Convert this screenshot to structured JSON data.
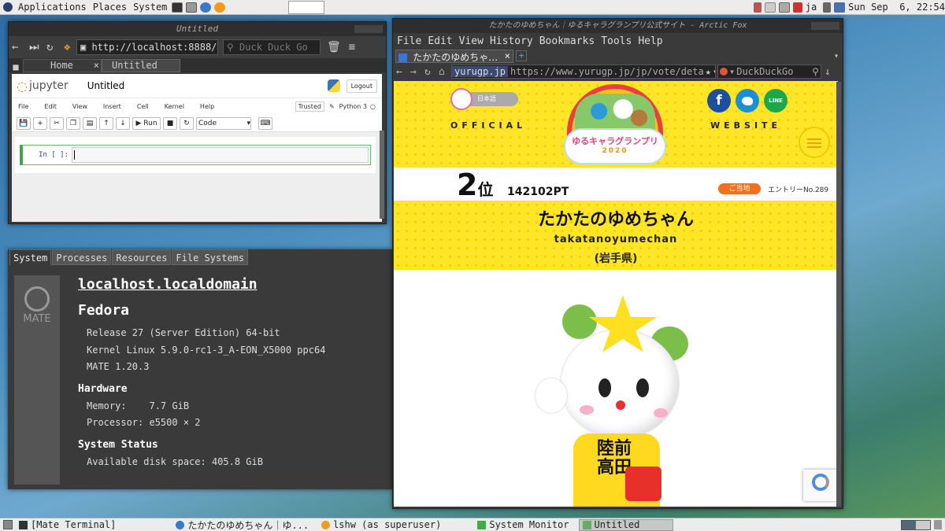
{
  "top_panel": {
    "menus": [
      "Applications",
      "Places",
      "System"
    ],
    "lang": "ja",
    "clock": "Sun Sep  6, 22:54"
  },
  "jupyter_window": {
    "title": "Untitled",
    "url": "http://localhost:8888/n",
    "search_placeholder": "Duck Duck Go",
    "tabs": [
      {
        "label": "Home"
      },
      {
        "label": "Untitled"
      }
    ],
    "app_name": "jupyter",
    "notebook_title": "Untitled",
    "logout": "Logout",
    "menu": [
      "File",
      "Edit",
      "View",
      "Insert",
      "Cell",
      "Kernel",
      "Help"
    ],
    "trusted": "Trusted",
    "kernel": "Python 3",
    "run": "Run",
    "cell_type": "Code",
    "prompt": "In [ ]:"
  },
  "sysmon": {
    "tabs": [
      "System",
      "Processes",
      "Resources",
      "File Systems"
    ],
    "logo_text": "MATE",
    "hostname": "localhost.localdomain",
    "os": "Fedora",
    "release": "Release 27 (Server Edition) 64-bit",
    "kernel": "Kernel Linux 5.9.0-rc1-3_A-EON_X5000 ppc64",
    "mate": "MATE 1.20.3",
    "hardware_heading": "Hardware",
    "memory_label": "Memory:",
    "memory_value": "7.7 GiB",
    "processor_label": "Processor:",
    "processor_value": "e5500 × 2",
    "status_heading": "System Status",
    "disk": "Available disk space: 405.8 GiB"
  },
  "browser_window": {
    "title": "たかたのゆめちゃん｜ゆるキャラグランプリ公式サイト - Arctic Fox",
    "menu": [
      "File",
      "Edit",
      "View",
      "History",
      "Bookmarks",
      "Tools",
      "Help"
    ],
    "tab": "たかたのゆめちゃ…",
    "identity": "yurugp.jp",
    "url": "https://www.yurugp.jp/jp/vote/deta",
    "search_placeholder": "DuckDuckGo"
  },
  "page": {
    "lang_button": "日本語",
    "official": "OFFICIAL",
    "website": "WEBSITE",
    "logo_text": "ゆるキャラグランプリ",
    "logo_year": "2020",
    "rank_num": "2",
    "rank_suffix": "位",
    "points": "142102PT",
    "badge": "ご当地",
    "entry": "エントリーNo.289",
    "name_jp": "たかたのゆめちゃん",
    "name_romaji": "takatanoyumechan",
    "prefecture": "(岩手県)",
    "mascot_text": "陸前高田",
    "facebook": "f",
    "line": "LINE"
  },
  "bottom_panel": {
    "tasks": [
      {
        "label": "[Mate Terminal]"
      },
      {
        "label": "たかたのゆめちゃん｜ゆ..."
      },
      {
        "label": "lshw (as superuser)"
      },
      {
        "label": "System Monitor"
      },
      {
        "label": "Untitled"
      }
    ]
  },
  "colors": {
    "site_yellow": "#ffe528",
    "badge_orange": "#f07020",
    "jupyter_orange": "#f37726"
  }
}
